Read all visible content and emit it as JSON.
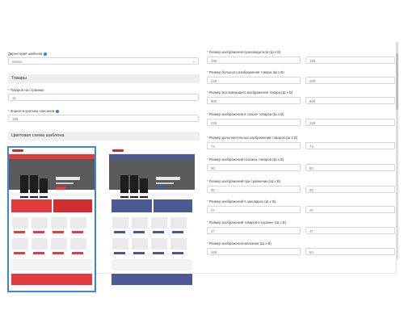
{
  "left": {
    "template_dir_label": "Директория шаблона",
    "template_dir_value": "newso",
    "goods_section": "Товары",
    "per_page_label": "Товаров на странице",
    "per_page_value": "15",
    "short_desc_label": "Знаков в кратком описании",
    "short_desc_value": "100",
    "color_scheme_section": "Цветовая схема шаблона"
  },
  "right": {
    "fields": [
      {
        "label": "Размер изображения производителя (Ш x В)",
        "w": "180",
        "h": "100"
      },
      {
        "label": "Размер большого изображения товара (Ш x В)",
        "w": "228",
        "h": "228"
      },
      {
        "label": "Размер всплывающего изображения товара (Ш x В)",
        "w": "800",
        "h": "800"
      },
      {
        "label": "Размер изображения в списке товаров (Ш x В)",
        "w": "228",
        "h": "228"
      },
      {
        "label": "Размер дополнительных изображений товаров (Ш x В)",
        "w": "74",
        "h": "74"
      },
      {
        "label": "Размер изображений похожих товаров (Ш x В)",
        "w": "80",
        "h": "80"
      },
      {
        "label": "Размер изображений при сравнении (Ш x В)",
        "w": "90",
        "h": "90"
      },
      {
        "label": "Размер изображений в закладках (Ш x В)",
        "w": "47",
        "h": "47"
      },
      {
        "label": "Размер изображений товаров в корзине (Ш x В)",
        "w": "47",
        "h": "47"
      },
      {
        "label": "Размер изображения магазина (Ш x В)",
        "w": "268",
        "h": "50"
      }
    ]
  },
  "colors": {
    "accent_blue": "#3a84f1",
    "red_scheme": "#e23b3b",
    "navy_scheme": "#4b5a97"
  }
}
